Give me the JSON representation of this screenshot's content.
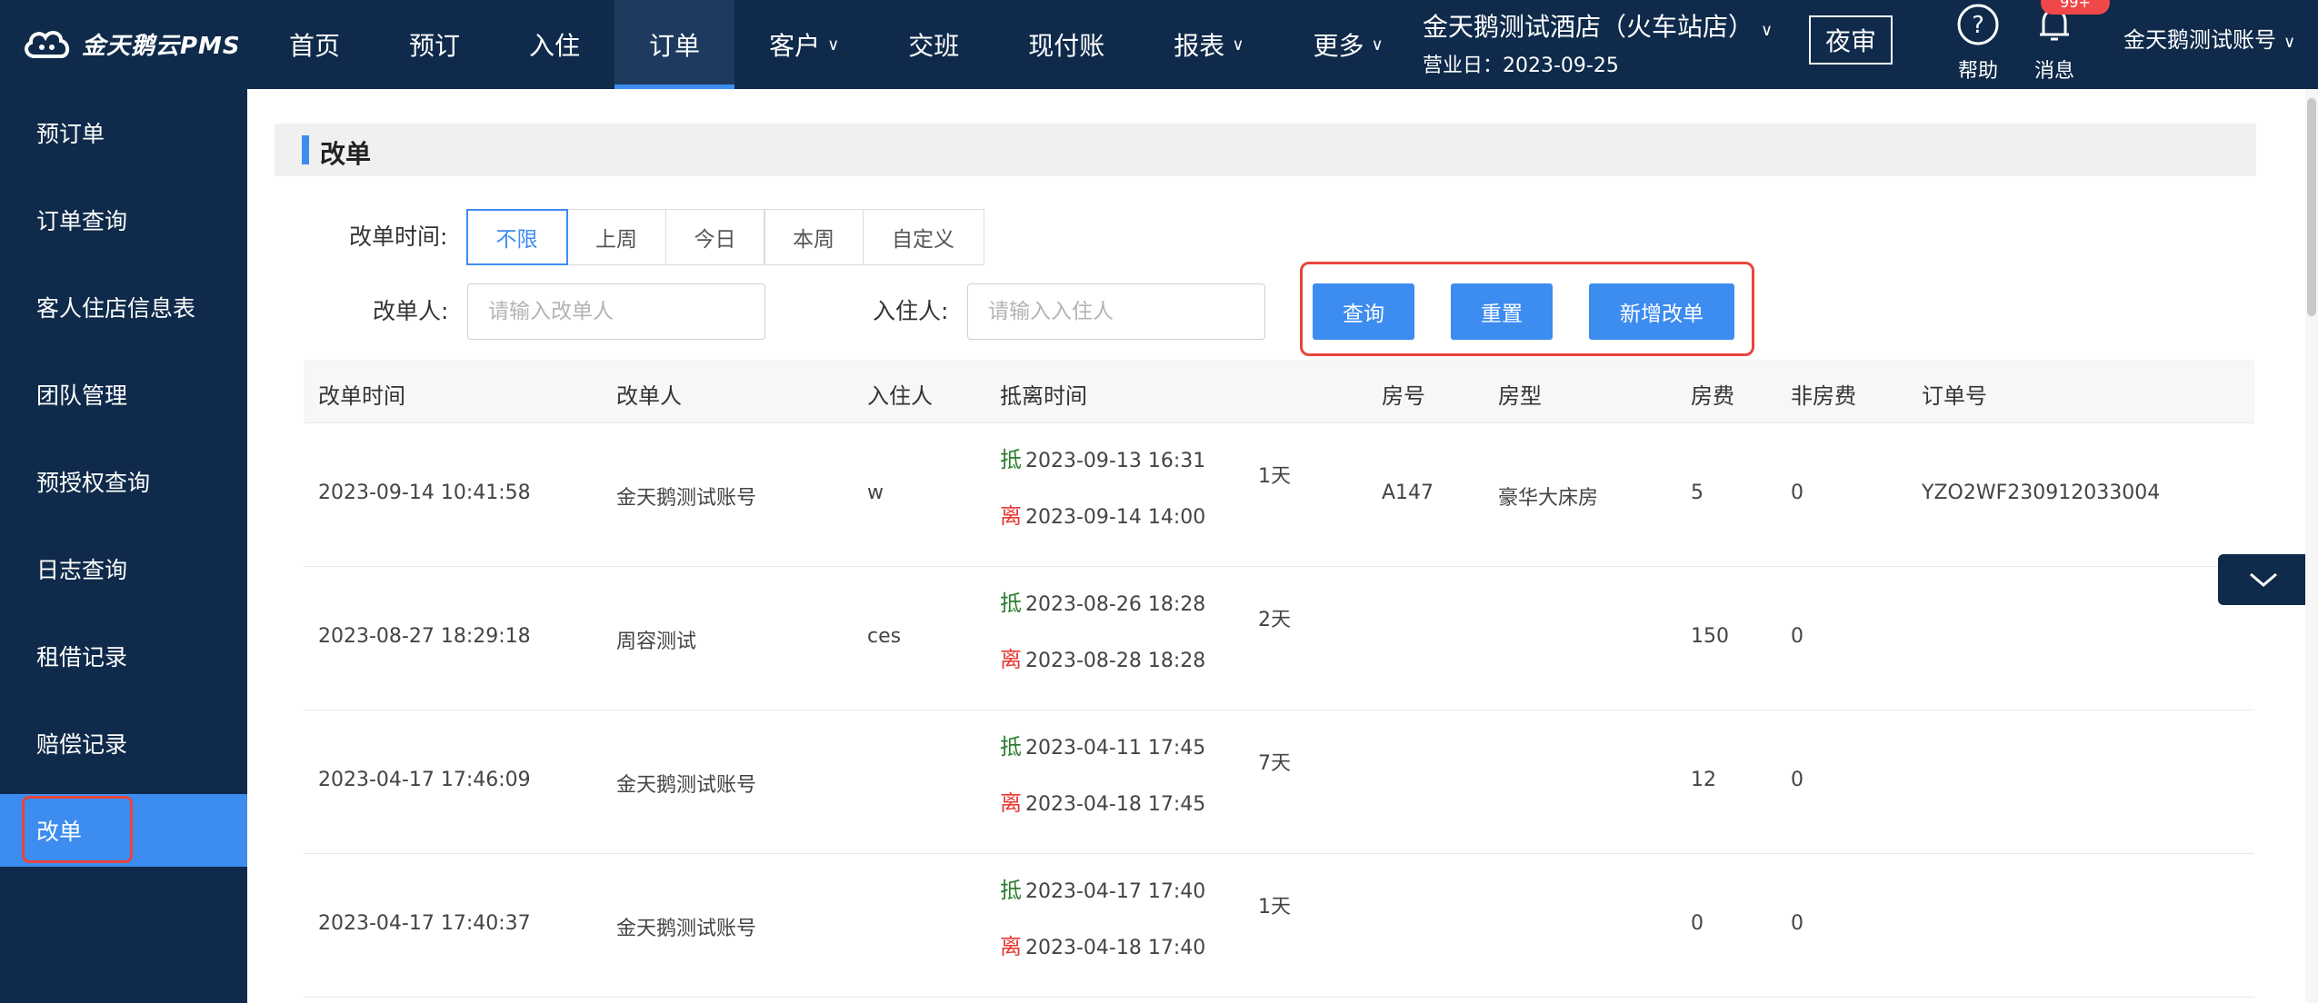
{
  "brand": {
    "name": "金天鹅云PMS"
  },
  "nav": {
    "items": [
      {
        "label": "首页",
        "dropdown": false
      },
      {
        "label": "预订",
        "dropdown": false
      },
      {
        "label": "入住",
        "dropdown": false
      },
      {
        "label": "订单",
        "dropdown": false,
        "active": true
      },
      {
        "label": "客户",
        "dropdown": true
      },
      {
        "label": "交班",
        "dropdown": false
      },
      {
        "label": "现付账",
        "dropdown": false
      },
      {
        "label": "报表",
        "dropdown": true
      },
      {
        "label": "更多",
        "dropdown": true
      }
    ]
  },
  "hotel": {
    "name": "金天鹅测试酒店（火车站店）",
    "business_date": "营业日：2023-09-25"
  },
  "header": {
    "audit_label": "夜审",
    "help_label": "帮助",
    "message_label": "消息",
    "message_badge": "99+",
    "account": "金天鹅测试账号"
  },
  "sidebar": {
    "items": [
      {
        "label": "预订单"
      },
      {
        "label": "订单查询"
      },
      {
        "label": "客人住店信息表"
      },
      {
        "label": "团队管理"
      },
      {
        "label": "预授权查询"
      },
      {
        "label": "日志查询"
      },
      {
        "label": "租借记录"
      },
      {
        "label": "赔偿记录"
      },
      {
        "label": "改单",
        "active": true
      }
    ]
  },
  "page": {
    "title": "改单"
  },
  "filters": {
    "time_label": "改单时间:",
    "time_options": [
      "不限",
      "上周",
      "今日",
      "本周",
      "自定义"
    ],
    "time_selected": "不限",
    "editor_label": "改单人:",
    "editor_placeholder": "请输入改单人",
    "guest_label": "入住人:",
    "guest_placeholder": "请输入入住人",
    "query_label": "查询",
    "reset_label": "重置",
    "add_label": "新增改单"
  },
  "table": {
    "columns": [
      "改单时间",
      "改单人",
      "入住人",
      "抵离时间",
      "房号",
      "房型",
      "房费",
      "非房费",
      "订单号"
    ],
    "arrive_tag": "抵",
    "depart_tag": "离",
    "rows": [
      {
        "time": "2023-09-14 10:41:58",
        "editor": "金天鹅测试账号",
        "guest": "w",
        "arrive": "2023-09-13 16:31",
        "depart": "2023-09-14 14:00",
        "nights": "1天",
        "room_no": "A147",
        "room_type": "豪华大床房",
        "room_fee": "5",
        "other_fee": "0",
        "order_no": "YZO2WF230912033004"
      },
      {
        "time": "2023-08-27 18:29:18",
        "editor": "周容测试",
        "guest": "ces",
        "arrive": "2023-08-26 18:28",
        "depart": "2023-08-28 18:28",
        "nights": "2天",
        "room_no": "",
        "room_type": "",
        "room_fee": "150",
        "other_fee": "0",
        "order_no": ""
      },
      {
        "time": "2023-04-17 17:46:09",
        "editor": "金天鹅测试账号",
        "guest": "",
        "arrive": "2023-04-11 17:45",
        "depart": "2023-04-18 17:45",
        "nights": "7天",
        "room_no": "",
        "room_type": "",
        "room_fee": "12",
        "other_fee": "0",
        "order_no": ""
      },
      {
        "time": "2023-04-17 17:40:37",
        "editor": "金天鹅测试账号",
        "guest": "",
        "arrive": "2023-04-17 17:40",
        "depart": "2023-04-18 17:40",
        "nights": "1天",
        "room_no": "",
        "room_type": "",
        "room_fee": "0",
        "other_fee": "0",
        "order_no": ""
      }
    ]
  },
  "colors": {
    "nav_bg": "#0f2a4a",
    "accent": "#3d8cf0",
    "highlight": "#e8453c"
  }
}
